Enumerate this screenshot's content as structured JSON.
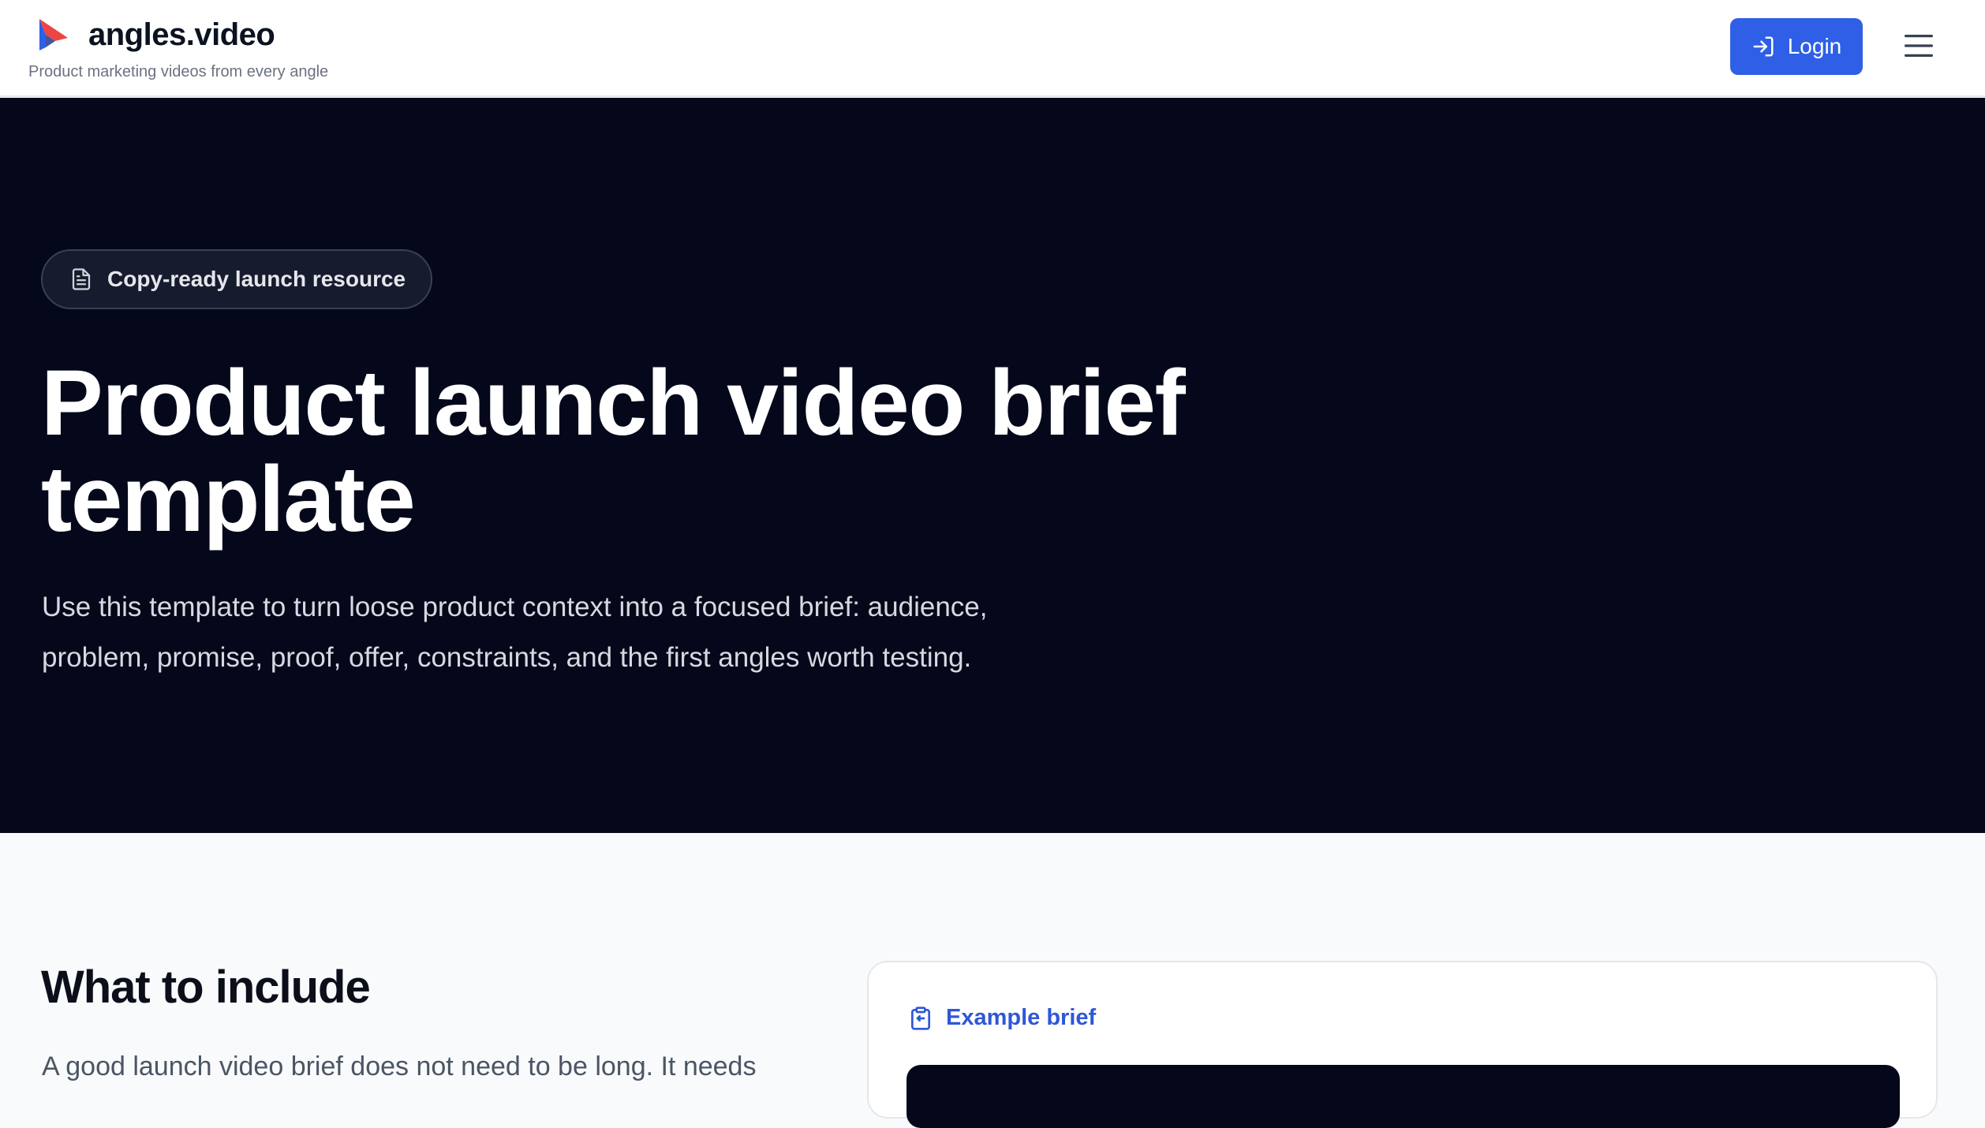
{
  "header": {
    "brand_name": "angles.video",
    "tagline": "Product marketing videos from every angle",
    "login_label": "Login",
    "icons": {
      "logo": "flag-logo-icon",
      "login": "login-arrow-icon",
      "menu": "hamburger-menu-icon"
    },
    "colors": {
      "login_bg": "#2f5fe6",
      "logo_blue": "#2f5fe6",
      "logo_red": "#ef4444"
    }
  },
  "hero": {
    "badge_label": "Copy-ready launch resource",
    "badge_icon": "document-icon",
    "title": "Product launch video brief template",
    "description": "Use this template to turn loose product context into a focused brief: audience, problem, promise, proof, offer, constraints, and the first angles worth testing.",
    "colors": {
      "background": "#05081b",
      "title": "#ffffff"
    }
  },
  "content": {
    "heading": "What to include",
    "intro": "A good launch video brief does not need to be long. It needs",
    "example": {
      "label": "Example brief",
      "icon": "clipboard-icon",
      "accent": "#2f57d8"
    }
  }
}
